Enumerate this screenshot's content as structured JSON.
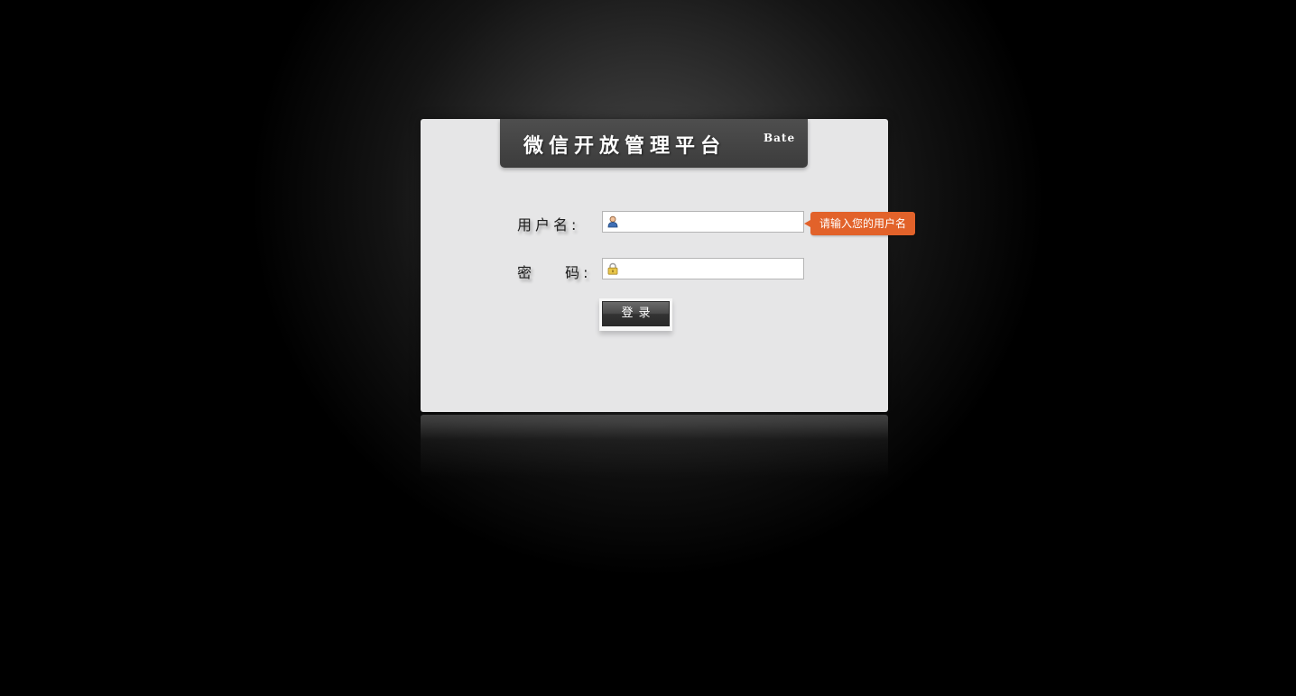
{
  "header": {
    "title": "微信开放管理平台",
    "tag": "Bate"
  },
  "form": {
    "username": {
      "label": "用户名:",
      "value": "",
      "tooltip": "请输入您的用户名",
      "icon": "user-icon"
    },
    "password": {
      "label": "密 码:",
      "value": "",
      "icon": "lock-icon"
    },
    "login_label": "登录"
  },
  "colors": {
    "background": "#000000",
    "panel": "#e6e6e7",
    "title_bar": "#444444",
    "tooltip": "#e2622a",
    "button": "#3c3c3c"
  }
}
